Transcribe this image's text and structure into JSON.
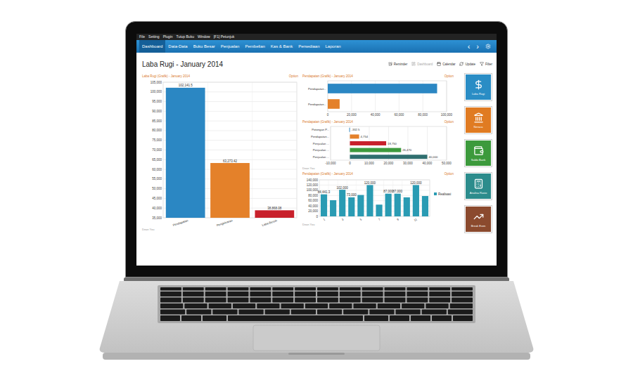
{
  "menu_bar": [
    "File",
    "Setting",
    "Plugin",
    "Tutup Buku",
    "Window",
    "[F1] Petunjuk"
  ],
  "nav": {
    "tabs": [
      {
        "label": "Dashboard",
        "selected": true
      },
      {
        "label": "Data-Data",
        "selected": false
      },
      {
        "label": "Buku Besar",
        "selected": false
      },
      {
        "label": "Penjualan",
        "selected": false
      },
      {
        "label": "Pembelian",
        "selected": false
      },
      {
        "label": "Kas & Bank",
        "selected": false
      },
      {
        "label": "Persediaan",
        "selected": false
      },
      {
        "label": "Laporan",
        "selected": false
      }
    ],
    "prev": "‹",
    "next": "›"
  },
  "page": {
    "title": "Laba Rugi - January 2014",
    "toolbar": [
      {
        "label": "Reminder",
        "disabled": false
      },
      {
        "label": "Dashboard",
        "disabled": true
      },
      {
        "label": "Calendar",
        "disabled": false
      },
      {
        "label": "Update",
        "disabled": false
      },
      {
        "label": "Filter",
        "disabled": false
      }
    ]
  },
  "charts": {
    "profit_loss": {
      "title": "Laba Rugi (Grafik) - January 2014",
      "option": "Option",
      "footer": "Dean You",
      "y_ticks": [
        "105,000",
        "100,000",
        "95,000",
        "90,000",
        "85,000",
        "80,000",
        "75,000",
        "70,000",
        "65,000",
        "60,000",
        "55,000",
        "50,000",
        "45,000",
        "40,000",
        "35,000"
      ],
      "bars": [
        {
          "label": "Pendapatan",
          "value": 102141.5,
          "reading": "102,141.5",
          "color": "#2b87c3"
        },
        {
          "label": "Pengeluaran",
          "value": 63273.42,
          "reading": "63,273.42",
          "color": "#e4812a"
        },
        {
          "label": "Laba Bersih",
          "value": 38868.08,
          "reading": "38,868.08",
          "color": "#c8202b"
        }
      ]
    },
    "income_summary": {
      "title": "Pendapatan (Grafik) - January 2014",
      "option": "Option",
      "footer": "",
      "x_ticks": [
        "0",
        "20,000",
        "40,000",
        "60,000",
        "80,000",
        "100,000"
      ],
      "bars": [
        {
          "label": "Pendapatan...",
          "value": 92000,
          "reading": "",
          "color": "#2b87c3"
        },
        {
          "label": "Pendapatan...",
          "value": 10000,
          "reading": "",
          "color": "#e4812a"
        }
      ]
    },
    "income_detail": {
      "title": "Pendapatan (Grafik) - January 2014",
      "option": "Option",
      "footer": "Dean You",
      "x_ticks": [
        "-10,000",
        "0",
        "10,000",
        "20,000",
        "30,000",
        "40,000",
        "50,000"
      ],
      "bars": [
        {
          "label": "Potongan P...",
          "value": -332.5,
          "reading": "-332.5",
          "color": "#2b87c3"
        },
        {
          "label": "Pendapatan...",
          "value": 4754,
          "reading": "4,754",
          "color": "#e4812a"
        },
        {
          "label": "Penjualan ...",
          "value": 18750,
          "reading": "18,750",
          "color": "#c8202b"
        },
        {
          "label": "Penjualan ...",
          "value": 26470,
          "reading": "26,470",
          "color": "#3d9a3d"
        },
        {
          "label": "Penjualan ...",
          "value": 40000,
          "reading": "40,000",
          "color": "#2f6f6f"
        }
      ]
    },
    "income_monthly": {
      "title": "Pendapatan (Grafik) - January 2014",
      "option": "Option",
      "footer": "Dean You",
      "y_ticks": [
        "140,000",
        "120,000",
        "100,000",
        "80,000",
        "60,000",
        "40,000",
        "20,000",
        "0"
      ],
      "x_ticks": [
        "1",
        "3",
        "5",
        "7",
        "9",
        "11"
      ],
      "series": {
        "name": "Realisasi",
        "color": "#2a9bb3",
        "values": [
          84441.3,
          62000,
          102000,
          73000,
          82000,
          120000,
          45000,
          87000,
          87000,
          73000,
          120000,
          78000
        ],
        "readings": [
          "84,441.3",
          "",
          "102,000",
          "73,000",
          "",
          "120,000",
          "",
          "87,000",
          "87,000",
          "",
          "120,000",
          ""
        ]
      }
    }
  },
  "shortcuts": [
    {
      "label": "Laba Rugi",
      "color": "#2a8dc5"
    },
    {
      "label": "Neraca",
      "color": "#e07b22"
    },
    {
      "label": "Saldo Bank",
      "color": "#3c9a3c"
    },
    {
      "label": "Analisa Rasio",
      "color": "#2c8c8c"
    },
    {
      "label": "Break Even",
      "color": "#8b4a2e"
    }
  ]
}
